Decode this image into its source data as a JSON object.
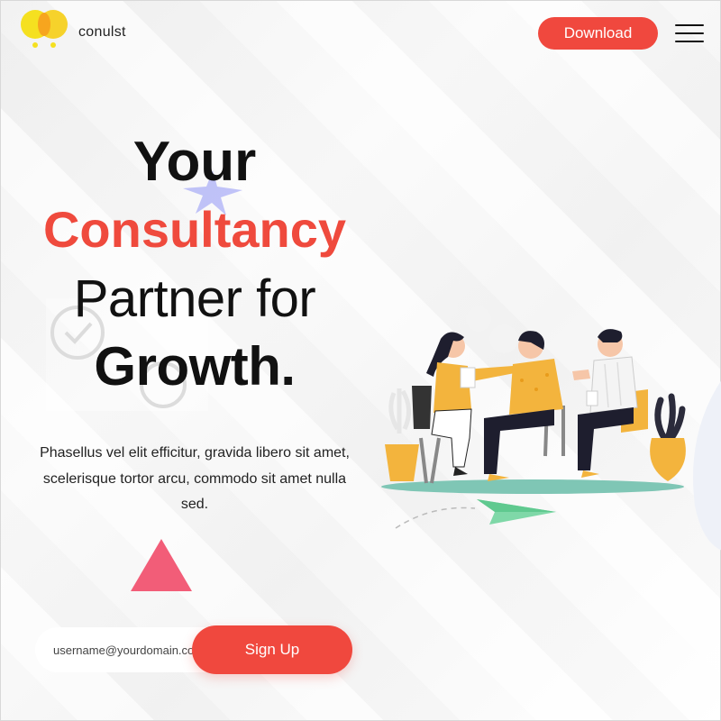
{
  "header": {
    "brand": "conulst",
    "download_label": "Download"
  },
  "hero": {
    "line1": "Your",
    "line2": "Consultancy",
    "line3": "Partner for",
    "line4": "Growth.",
    "description": "Phasellus vel elit efficitur, gravida libero sit amet, scelerisque tortor arcu, commodo sit amet nulla sed."
  },
  "signup": {
    "placeholder": "username@yourdomain.com",
    "button_label": "Sign Up"
  },
  "colors": {
    "accent": "#f0483e",
    "logo_yellow": "#f5e020",
    "logo_orange": "#f7a51e",
    "triangle": "#f25d78"
  },
  "icons": [
    "logo-icon",
    "menu-icon",
    "star-burst-icon",
    "check-circle-icon",
    "triangle-shape",
    "paper-plane-icon"
  ]
}
